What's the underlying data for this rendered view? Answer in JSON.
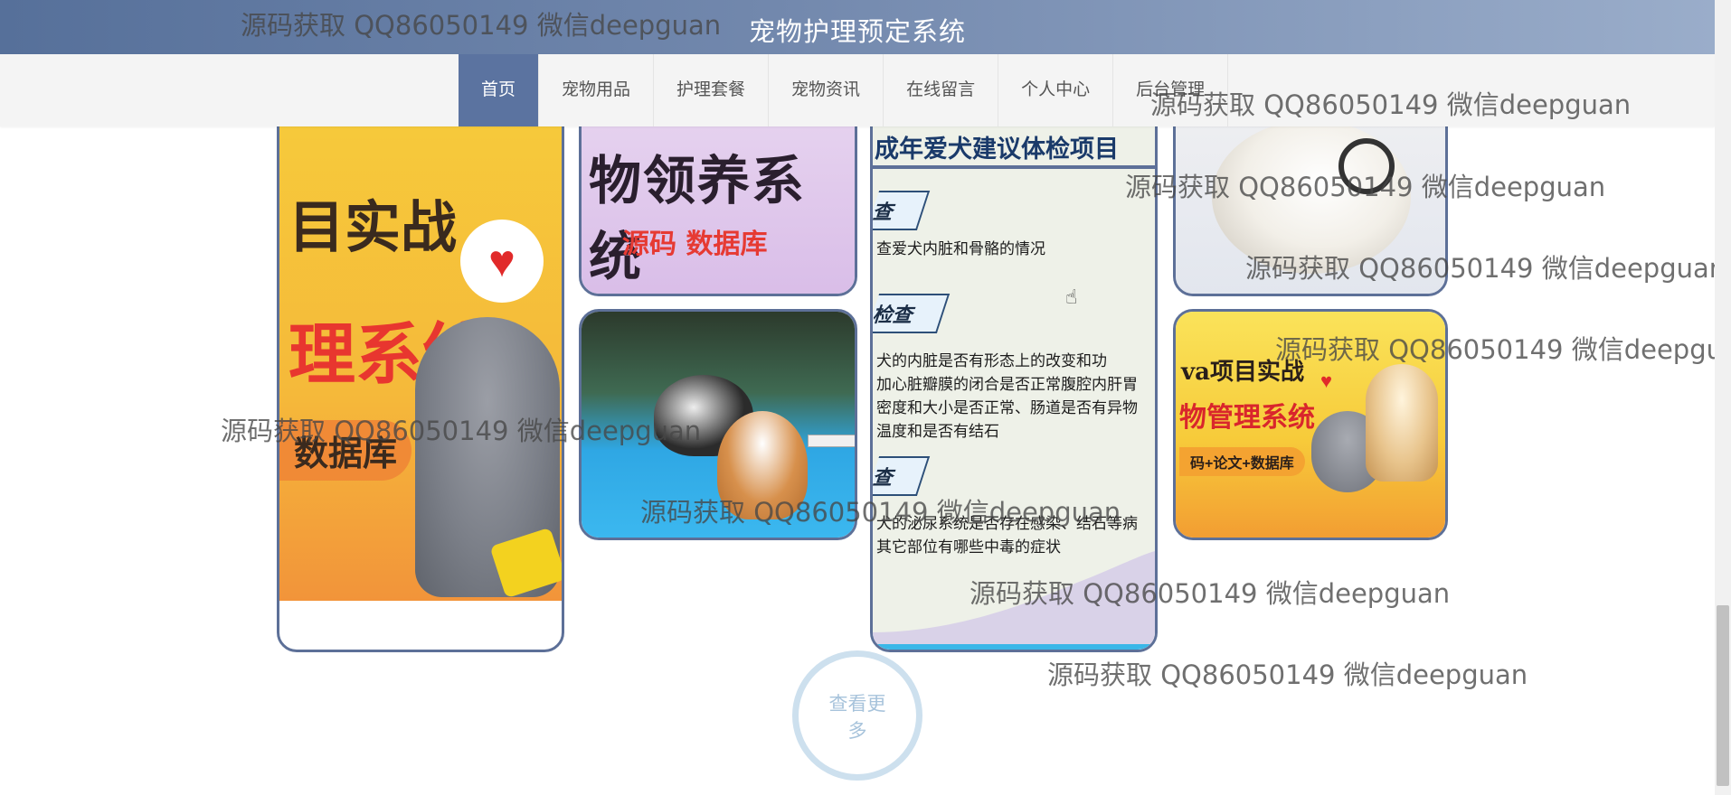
{
  "header": {
    "title": "宠物护理预定系统"
  },
  "nav": {
    "items": [
      {
        "label": "首页",
        "active": true
      },
      {
        "label": "宠物用品",
        "active": false
      },
      {
        "label": "护理套餐",
        "active": false
      },
      {
        "label": "宠物资讯",
        "active": false
      },
      {
        "label": "在线留言",
        "active": false
      },
      {
        "label": "个人中心",
        "active": false
      },
      {
        "label": "后台管理",
        "active": false
      }
    ]
  },
  "gallery": {
    "card_a": {
      "line1": "目实战",
      "line2": "理系统",
      "line3": "数据库",
      "heart": "♥"
    },
    "card_b": {
      "title": "物领养系统",
      "subtitle": "源码 数据库"
    },
    "card_d": {
      "title": "成年爱犬建议体检项目",
      "section1": "查",
      "line1": "查爱犬内脏和骨骼的情况",
      "section2": "检查",
      "line2": "犬的内脏是否有形态上的改变和功",
      "line3": "加心脏瓣膜的闭合是否正常腹腔内肝胃",
      "line4": "密度和大小是否正常、肠道是否有异物",
      "line5": "温度和是否有结石",
      "section3": "查",
      "line6": "犬的泌尿系统是否存在感染、结石等病",
      "line7": "其它部位有哪些中毒的症状"
    },
    "card_f": {
      "line1": "va项目实战",
      "line2": "物管理系统",
      "line3": "码+论文+数据库",
      "heart": "♥"
    }
  },
  "view_more": {
    "line1": "查看更",
    "line2": "多"
  },
  "watermark_text": "源码获取 QQ86050149 微信deepguan",
  "colors": {
    "header_start": "#56709a",
    "header_end": "#9aadca",
    "nav_active": "#5b73a0",
    "card_border": "#5d7098",
    "view_more_border": "#cde0ee"
  }
}
